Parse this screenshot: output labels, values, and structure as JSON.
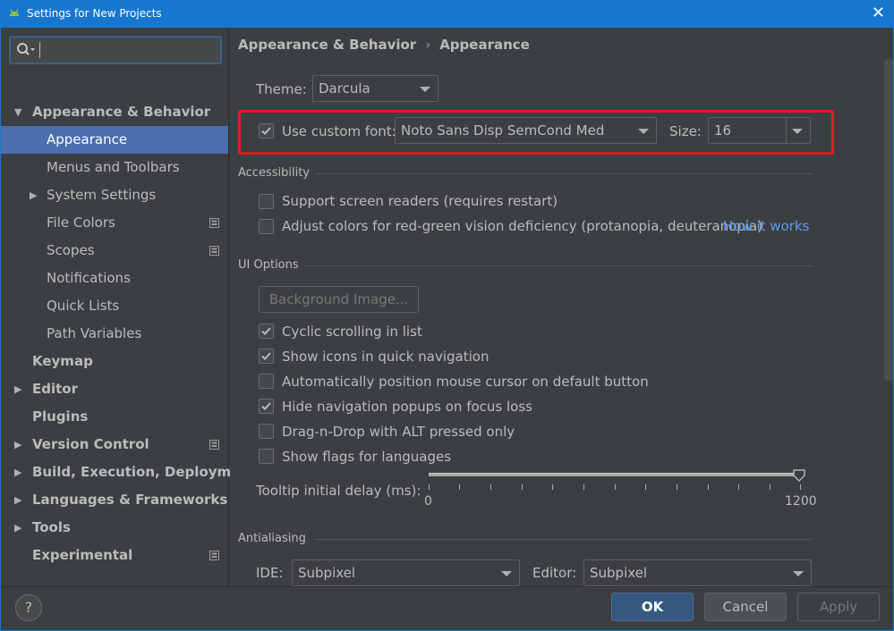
{
  "window": {
    "title": "Settings for New Projects",
    "close_glyph": "✕"
  },
  "search": {
    "value": ""
  },
  "sidebar": {
    "items": [
      {
        "label": "Appearance & Behavior",
        "arrow": "▼"
      },
      {
        "label": "Appearance"
      },
      {
        "label": "Menus and Toolbars"
      },
      {
        "label": "System Settings",
        "arrow": "▶"
      },
      {
        "label": "File Colors"
      },
      {
        "label": "Scopes"
      },
      {
        "label": "Notifications"
      },
      {
        "label": "Quick Lists"
      },
      {
        "label": "Path Variables"
      },
      {
        "label": "Keymap"
      },
      {
        "label": "Editor",
        "arrow": "▶"
      },
      {
        "label": "Plugins"
      },
      {
        "label": "Version Control",
        "arrow": "▶"
      },
      {
        "label": "Build, Execution, Deployment",
        "arrow": "▶"
      },
      {
        "label": "Languages & Frameworks",
        "arrow": "▶"
      },
      {
        "label": "Tools",
        "arrow": "▶"
      },
      {
        "label": "Experimental"
      }
    ]
  },
  "breadcrumb": {
    "parent": "Appearance & Behavior",
    "separator": "›",
    "current": "Appearance"
  },
  "theme": {
    "label": "Theme:",
    "value": "Darcula"
  },
  "custom_font": {
    "checked": true,
    "label": "Use custom font:",
    "font": "Noto Sans Disp SemCond Med",
    "size_label": "Size:",
    "size": "16"
  },
  "accessibility": {
    "title": "Accessibility",
    "screen_readers": {
      "checked": false,
      "label": "Support screen readers (requires restart)"
    },
    "color_vision": {
      "checked": false,
      "label": "Adjust colors for red-green vision deficiency (protanopia, deuteranopia)"
    },
    "how_it_works": "How it works"
  },
  "ui_options": {
    "title": "UI Options",
    "background_image_button": "Background Image...",
    "options": [
      {
        "checked": true,
        "label": "Cyclic scrolling in list"
      },
      {
        "checked": true,
        "label": "Show icons in quick navigation"
      },
      {
        "checked": false,
        "label": "Automatically position mouse cursor on default button"
      },
      {
        "checked": true,
        "label": "Hide navigation popups on focus loss"
      },
      {
        "checked": false,
        "label": "Drag-n-Drop with ALT pressed only"
      },
      {
        "checked": false,
        "label": "Show flags for languages"
      }
    ],
    "tooltip_delay": {
      "label": "Tooltip initial delay (ms):",
      "min": "0",
      "max": "1200",
      "value": 1200
    }
  },
  "antialiasing": {
    "title": "Antialiasing",
    "ide_label": "IDE:",
    "ide_value": "Subpixel",
    "editor_label": "Editor:",
    "editor_value": "Subpixel"
  },
  "buttons": {
    "help": "?",
    "ok": "OK",
    "cancel": "Cancel",
    "apply": "Apply"
  },
  "colors": {
    "accent": "#4b6eaf",
    "title_bar": "#1777d0",
    "highlight": "#e01b24",
    "link": "#589df6"
  }
}
